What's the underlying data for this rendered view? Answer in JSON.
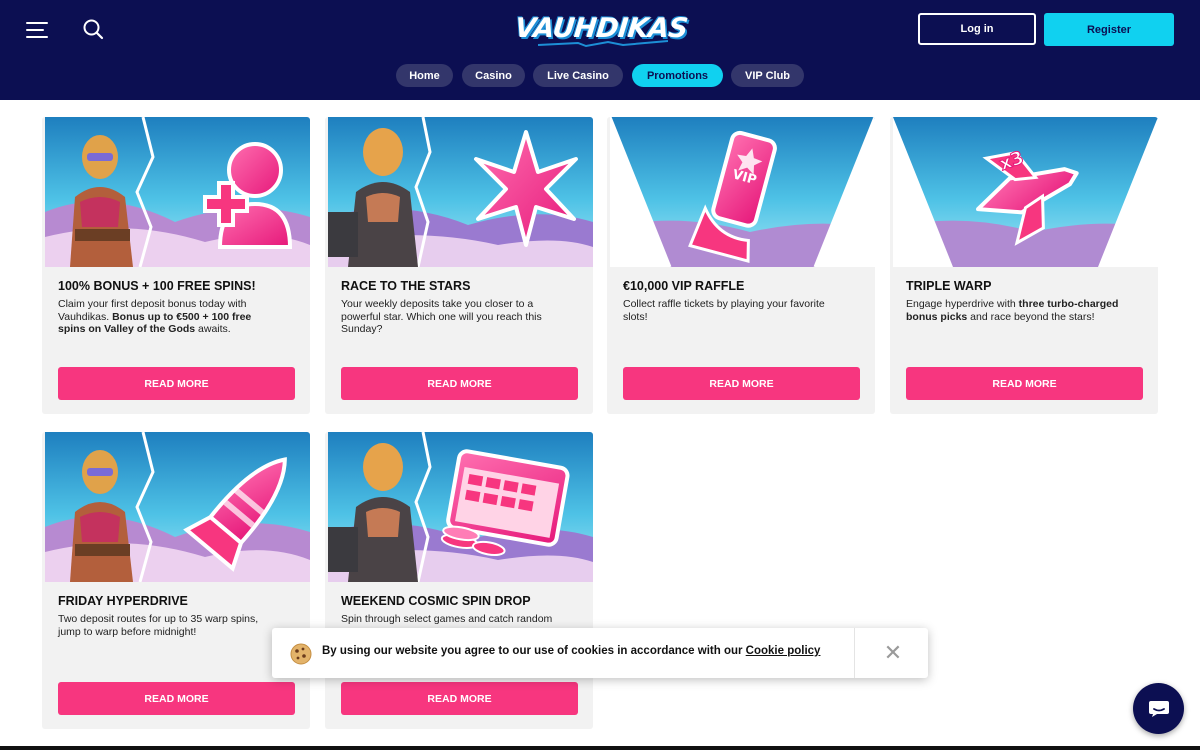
{
  "header": {
    "logo": "VAUHDIKAS",
    "login_label": "Log in",
    "register_label": "Register",
    "colors": {
      "background": "#0c0f52",
      "accent": "#10d1f0",
      "cta": "#f7367f"
    }
  },
  "nav": {
    "items": [
      {
        "label": "Home"
      },
      {
        "label": "Casino"
      },
      {
        "label": "Live Casino"
      },
      {
        "label": "Promotions",
        "active": true
      },
      {
        "label": "VIP Club"
      }
    ]
  },
  "promotions": [
    {
      "title": "100% BONUS + 100 FREE SPINS!",
      "desc_1": "Claim your first deposit bonus today with Vauhdikas. ",
      "desc_bold": "Bonus up to €500 + 100 free spins on Valley of the Gods",
      "desc_2": " awaits.",
      "button": "READ MORE",
      "icon": "add-user-icon"
    },
    {
      "title": "RACE TO THE STARS",
      "desc_1": "Your weekly deposits take you closer to a powerful star. Which one will you reach this Sunday?",
      "button": "READ MORE",
      "icon": "star-icon"
    },
    {
      "title": "€10,000 VIP RAFFLE",
      "desc_1": "Collect raffle tickets by playing your favorite slots!",
      "button": "READ MORE",
      "icon": "vip-ticket-icon",
      "badge": "VIP"
    },
    {
      "title": "TRIPLE WARP",
      "desc_1": "Engage hyperdrive with ",
      "desc_bold": "three turbo-charged bonus picks",
      "desc_2": " and race beyond the stars!",
      "button": "READ MORE",
      "icon": "spaceship-x3-icon",
      "badge": "x3"
    },
    {
      "title": "FRIDAY HYPERDRIVE",
      "desc_1": "Two deposit routes for up to 35 warp spins, jump to warp before midnight!",
      "button": "READ MORE",
      "icon": "rocket-icon"
    },
    {
      "title": "WEEKEND COSMIC SPIN DROP",
      "desc_1": "Spin through select games and catch random",
      "button": "READ MORE",
      "icon": "calendar-chips-icon"
    }
  ],
  "cookie": {
    "text": "By using our website you agree to our use of cookies in accordance with our ",
    "link": "Cookie policy",
    "close_icon": "close-icon"
  },
  "chat": {
    "icon": "chat-icon"
  }
}
